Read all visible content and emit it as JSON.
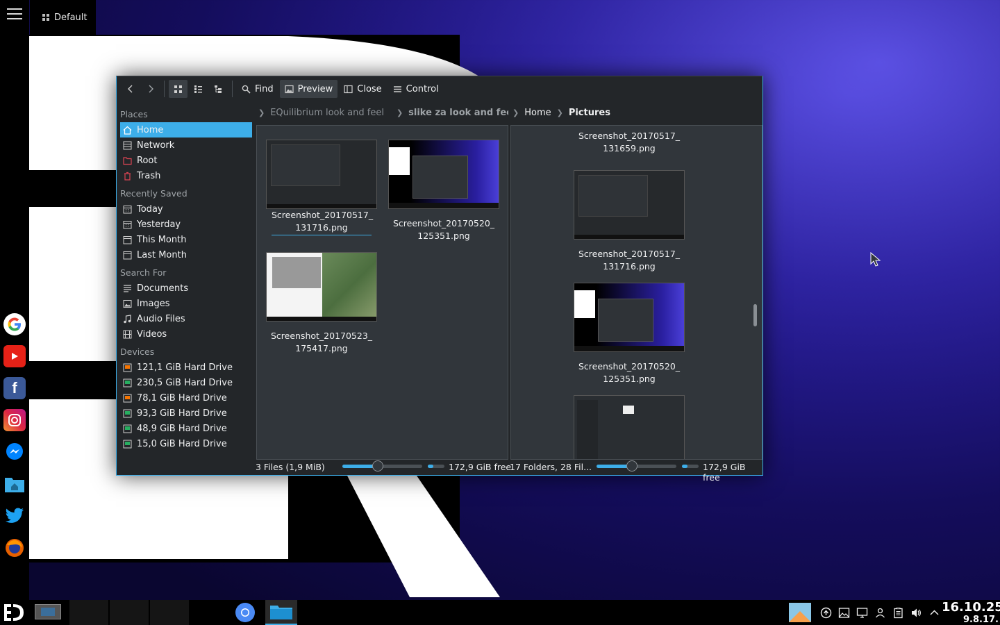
{
  "activity": {
    "label": "Default"
  },
  "toolbar": {
    "find_label": "Find",
    "preview_label": "Preview",
    "close_label": "Close",
    "control_label": "Control"
  },
  "sidebar": {
    "places_title": "Places",
    "places": [
      "Home",
      "Network",
      "Root",
      "Trash"
    ],
    "recent_title": "Recently Saved",
    "recent": [
      "Today",
      "Yesterday",
      "This Month",
      "Last Month"
    ],
    "search_title": "Search For",
    "search": [
      "Documents",
      "Images",
      "Audio Files",
      "Videos"
    ],
    "devices_title": "Devices",
    "devices": [
      "121,1 GiB Hard Drive",
      "230,5 GiB Hard Drive",
      "78,1 GiB Hard Drive",
      "93,3 GiB Hard Drive",
      "48,9 GiB Hard Drive",
      "15,0 GiB Hard Drive"
    ]
  },
  "left_pane": {
    "breadcrumb": [
      "EQuilibrium look and feel",
      "slike za look and feel"
    ],
    "files": [
      {
        "line1": "Screenshot_20170517_",
        "line2": "131716.png"
      },
      {
        "line1": "Screenshot_20170520_",
        "line2": "125351.png"
      },
      {
        "line1": "Screenshot_20170523_",
        "line2": "175417.png"
      }
    ],
    "status": "3 Files (1,9 MiB)",
    "free": "172,9 GiB free",
    "zoom": 0.44,
    "capacity_used": 0.35
  },
  "right_pane": {
    "breadcrumb": [
      "Home",
      "Pictures"
    ],
    "files": [
      {
        "line1": "Screenshot_20170517_",
        "line2": "131659.png"
      },
      {
        "line1": "Screenshot_20170517_",
        "line2": "131716.png"
      },
      {
        "line1": "Screenshot_20170520_",
        "line2": "125351.png"
      }
    ],
    "status": "17 Folders, 28 Fil...",
    "free": "172,9 GiB free",
    "zoom": 0.44,
    "capacity_used": 0.35
  },
  "clock": {
    "time": "16.10.25",
    "date": "9.8.17."
  },
  "colors": {
    "accent": "#3daee9",
    "window_bg": "#232629",
    "pane_bg": "#31363b"
  }
}
